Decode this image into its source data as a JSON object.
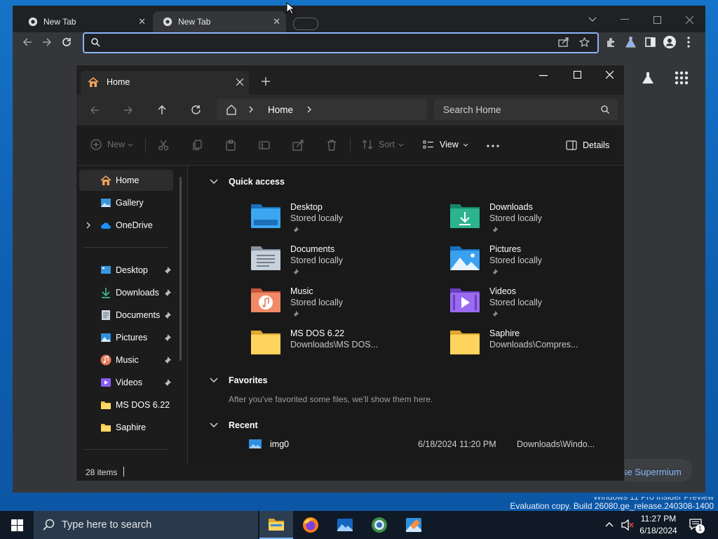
{
  "chrome": {
    "tabs": [
      {
        "title": "New Tab"
      },
      {
        "title": "New Tab"
      }
    ],
    "side_button_label": "se Supermium"
  },
  "explorer": {
    "tab_title": "Home",
    "breadcrumb": "Home",
    "search_placeholder": "Search Home",
    "toolbar": {
      "new_label": "New",
      "sort_label": "Sort",
      "view_label": "View",
      "details_label": "Details"
    },
    "sidebar": {
      "top": [
        {
          "label": "Home"
        },
        {
          "label": "Gallery"
        },
        {
          "label": "OneDrive"
        }
      ],
      "pinned": [
        {
          "label": "Desktop"
        },
        {
          "label": "Downloads"
        },
        {
          "label": "Documents"
        },
        {
          "label": "Pictures"
        },
        {
          "label": "Music"
        },
        {
          "label": "Videos"
        },
        {
          "label": "MS DOS 6.22"
        },
        {
          "label": "Saphire"
        }
      ]
    },
    "sections": {
      "quick_access": "Quick access",
      "favorites": "Favorites",
      "favorites_empty": "After you've favorited some files, we'll show them here.",
      "recent": "Recent"
    },
    "quick_access": [
      {
        "name": "Desktop",
        "sub": "Stored locally",
        "icon": "desktop-folder-icon"
      },
      {
        "name": "Downloads",
        "sub": "Stored locally",
        "icon": "downloads-folder-icon"
      },
      {
        "name": "Documents",
        "sub": "Stored locally",
        "icon": "documents-folder-icon"
      },
      {
        "name": "Pictures",
        "sub": "Stored locally",
        "icon": "pictures-folder-icon"
      },
      {
        "name": "Music",
        "sub": "Stored locally",
        "icon": "music-folder-icon"
      },
      {
        "name": "Videos",
        "sub": "Stored locally",
        "icon": "videos-folder-icon"
      },
      {
        "name": "MS DOS 6.22",
        "sub": "Downloads\\MS DOS...",
        "icon": "folder-icon"
      },
      {
        "name": "Saphire",
        "sub": "Downloads\\Compres...",
        "icon": "folder-icon"
      }
    ],
    "recent": [
      {
        "name": "img0",
        "date": "6/18/2024 11:20 PM",
        "location": "Downloads\\Windo..."
      }
    ],
    "status": "28 items"
  },
  "watermark": {
    "line1": "Windows 11 Pro Insider Preview",
    "line2": "Evaluation copy. Build 26080.ge_release.240308-1400"
  },
  "taskbar": {
    "search_placeholder": "Type here to search",
    "time": "11:27 PM",
    "date": "6/18/2024",
    "notification_count": "1"
  },
  "colors": {
    "accent": "#0078d4",
    "chrome_focus": "#8ab4f8",
    "folder_yellow": "#f5c542"
  }
}
